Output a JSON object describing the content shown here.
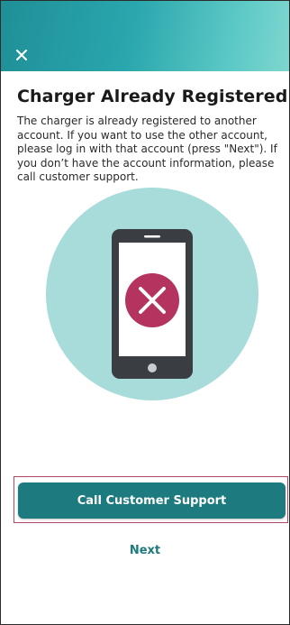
{
  "header": {
    "close_icon": "close-icon",
    "gradient_start": "#1f8f97",
    "gradient_end": "#7fd6cf"
  },
  "content": {
    "title": "Charger Already Registered",
    "description": "The charger is already registered to another account. If you want to use the other account, please log in with that account (press \"Next\"). If you don’t have the account information, please call customer support."
  },
  "illustration": {
    "icon": "phone-error-icon",
    "circle_color": "#a8dcdb",
    "phone_color": "#3a3d42",
    "error_color": "#b5345f"
  },
  "actions": {
    "call_support_label": "Call Customer Support",
    "next_label": "Next",
    "primary_color": "#1d7a7f"
  }
}
